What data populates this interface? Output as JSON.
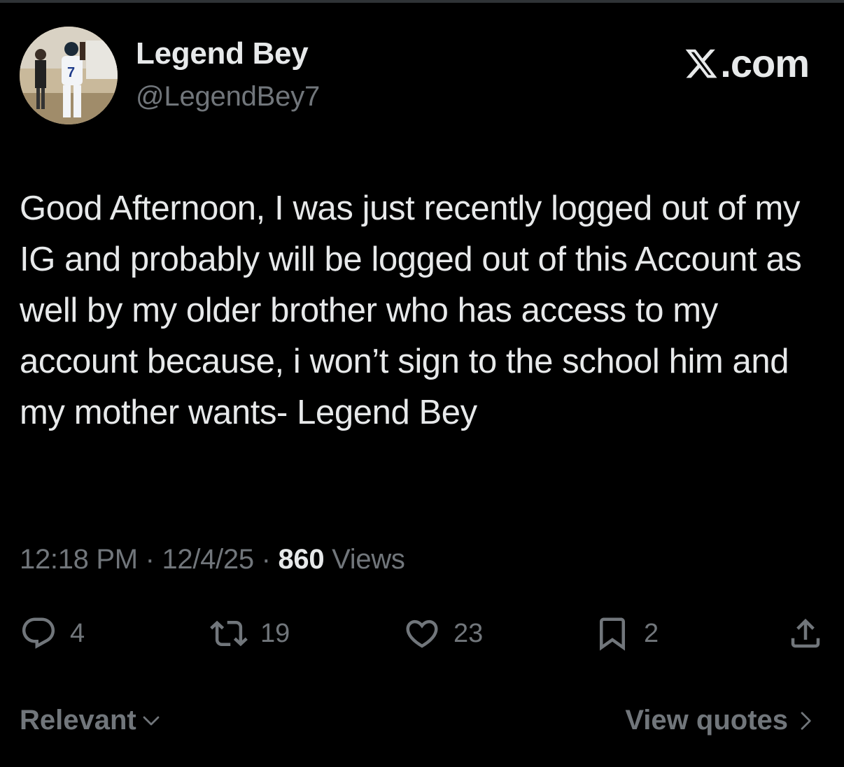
{
  "header": {
    "display_name": "Legend Bey",
    "handle": "@LegendBey7",
    "brand_text": ".com",
    "avatar_icon": "profile-photo-football-player"
  },
  "tweet": {
    "text": "Good Afternoon, I was just recently logged out of my IG and probably will be logged out of this Account as well by my older brother who has access to my account because, i won’t sign to the school him and my mother wants- Legend Bey"
  },
  "meta": {
    "time": "12:18 PM",
    "sep1": " · ",
    "date": "12/4/25",
    "sep2": " · ",
    "views_count": "860",
    "views_label": " Views"
  },
  "actions": {
    "replies": "4",
    "reposts": "19",
    "likes": "23",
    "bookmarks": "2"
  },
  "footer": {
    "sort_label": "Relevant",
    "quotes_label": "View quotes"
  },
  "colors": {
    "background": "#000000",
    "primary_text": "#e7e9ea",
    "secondary_text": "#71767b"
  }
}
